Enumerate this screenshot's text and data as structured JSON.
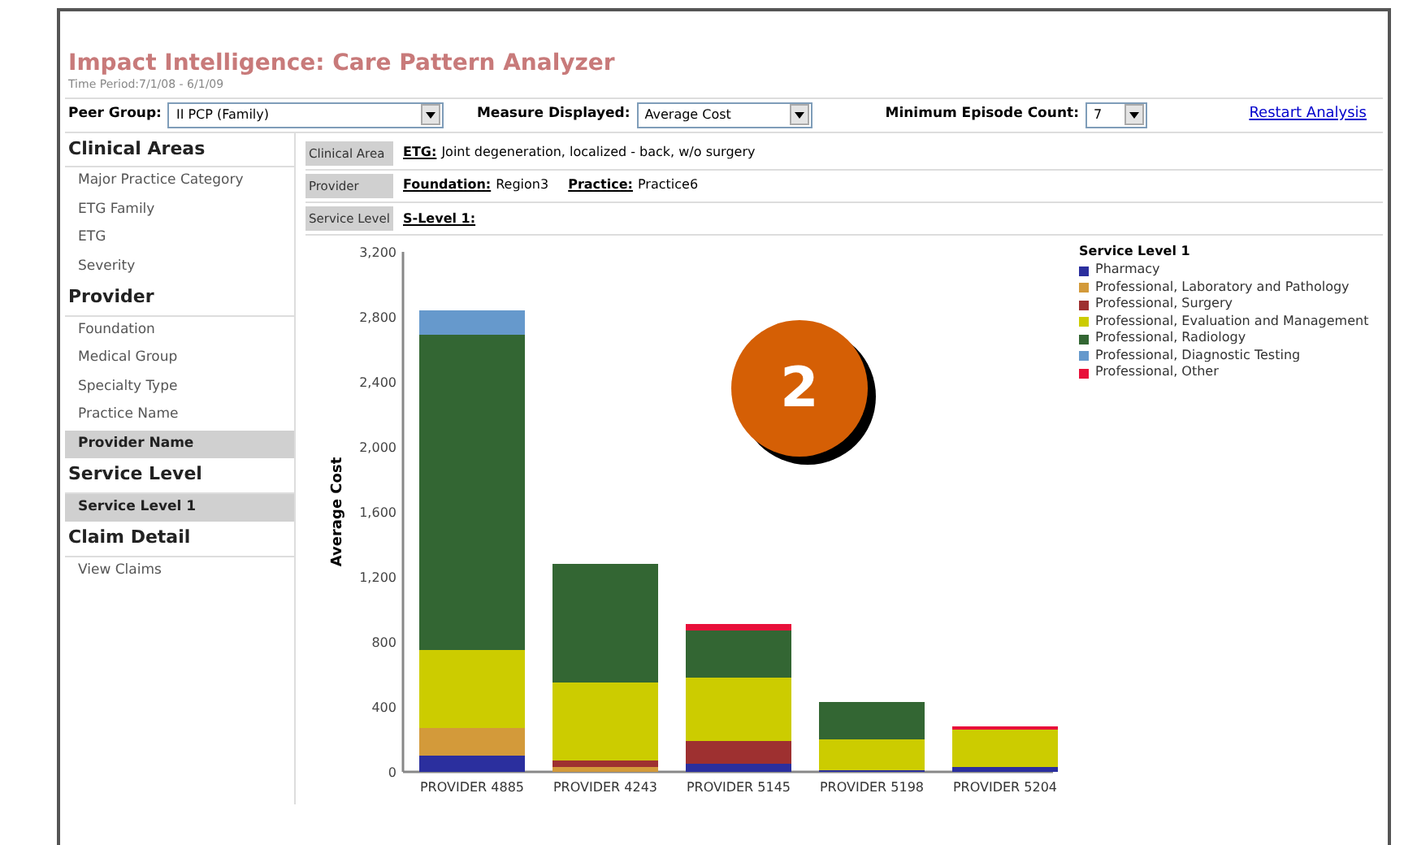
{
  "header": {
    "title": "Impact Intelligence: Care Pattern Analyzer",
    "subtitle": "Time Period:7/1/08 - 6/1/09"
  },
  "toolbar": {
    "fields": [
      {
        "label": "Peer Group:",
        "value": "II PCP (Family)"
      },
      {
        "label": "Measure Displayed:",
        "value": "Average Cost"
      },
      {
        "label": "Minimum Episode Count:",
        "value": "7"
      }
    ],
    "link": "Restart Analysis"
  },
  "sidebar": {
    "sections": [
      {
        "title": "Clinical Areas",
        "items": [
          {
            "label": "Major Practice Category",
            "selected": false
          },
          {
            "label": "ETG Family",
            "selected": false
          },
          {
            "label": "ETG",
            "selected": false
          },
          {
            "label": "Severity",
            "selected": false
          }
        ]
      },
      {
        "title": "Provider",
        "items": [
          {
            "label": "Foundation",
            "selected": false
          },
          {
            "label": "Medical Group",
            "selected": false
          },
          {
            "label": "Specialty Type",
            "selected": false
          },
          {
            "label": "Practice Name",
            "selected": false
          },
          {
            "label": "Provider Name",
            "selected": true
          }
        ]
      },
      {
        "title": "Service Level",
        "items": [
          {
            "label": "Service Level 1",
            "selected": true
          }
        ]
      },
      {
        "title": "Claim Detail",
        "items": [
          {
            "label": "View Claims",
            "selected": false
          }
        ]
      }
    ]
  },
  "filters": [
    {
      "label": "Clinical Area",
      "parts": [
        {
          "key": "ETG:",
          "value": "Joint degeneration, localized - back, w/o surgery"
        }
      ]
    },
    {
      "label": "Provider",
      "parts": [
        {
          "key": "Foundation:",
          "value": "Region3"
        },
        {
          "key": "Practice:",
          "value": "Practice6"
        }
      ]
    },
    {
      "label": "Service Level",
      "parts": [
        {
          "key": "S-Level 1:"
        }
      ]
    }
  ],
  "chart_data": {
    "type": "bar",
    "stacked": true,
    "legend": "right",
    "ylabel": "Average Cost",
    "title": "Service Level 1",
    "categories": [
      "PROVIDER 4885",
      "PROVIDER 4243",
      "PROVIDER 5145",
      "PROVIDER 5198",
      "PROVIDER 5204"
    ],
    "ylim": [
      0,
      3200
    ],
    "yticks": [
      {
        "value": 0,
        "label": "0"
      },
      {
        "value": 400,
        "label": "400"
      },
      {
        "value": 800,
        "label": "800"
      },
      {
        "value": 1200,
        "label": "1,200"
      },
      {
        "value": 1600,
        "label": "1,600"
      },
      {
        "value": 2000,
        "label": "2,000"
      },
      {
        "value": 2400,
        "label": "2,400"
      },
      {
        "value": 2800,
        "label": "2,800"
      },
      {
        "value": 3200,
        "label": "3,200"
      }
    ],
    "series": [
      {
        "name": "Pharmacy",
        "color": "#2b2f9e",
        "values": [
          100,
          0,
          50,
          10,
          30
        ]
      },
      {
        "name": "Professional, Laboratory and Pathology",
        "color": "#d39a3a",
        "values": [
          170,
          30,
          0,
          0,
          0
        ]
      },
      {
        "name": "Professional, Surgery",
        "color": "#9e3030",
        "values": [
          0,
          40,
          140,
          0,
          0
        ]
      },
      {
        "name": "Professional, Evaluation and Management",
        "color": "#cccc00",
        "values": [
          480,
          480,
          390,
          190,
          230
        ]
      },
      {
        "name": "Professional, Radiology",
        "color": "#336633",
        "values": [
          1940,
          730,
          290,
          230,
          0
        ]
      },
      {
        "name": "Professional, Diagnostic Testing",
        "color": "#6699cc",
        "values": [
          150,
          0,
          0,
          0,
          0
        ]
      },
      {
        "name": "Professional, Other",
        "color": "#e8103a",
        "values": [
          0,
          0,
          40,
          0,
          20
        ]
      }
    ]
  },
  "badge": {
    "text": "2"
  }
}
